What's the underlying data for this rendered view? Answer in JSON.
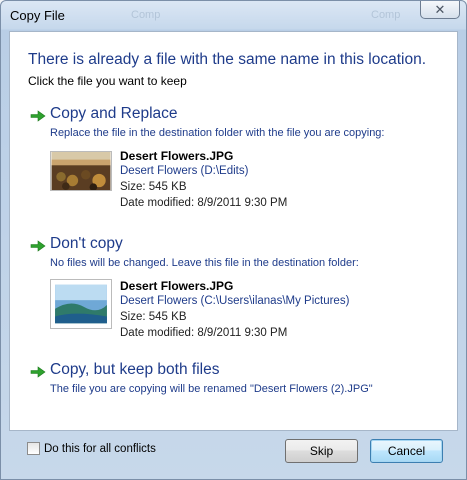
{
  "window": {
    "title": "Copy File",
    "ghost_left": "Comp",
    "ghost_right": "Comp"
  },
  "heading": "There is already a file with the same name in this location.",
  "subheading": "Click the file you want to keep",
  "options": [
    {
      "title": "Copy and Replace",
      "description": "Replace the file in the destination folder with the file you are copying:",
      "file": {
        "name": "Desert Flowers.JPG",
        "path": "Desert Flowers (D:\\Edits)",
        "size": "Size: 545 KB",
        "date": "Date modified: 8/9/2011 9:30 PM"
      }
    },
    {
      "title": "Don't copy",
      "description": "No files will be changed. Leave this file in the destination folder:",
      "file": {
        "name": "Desert Flowers.JPG",
        "path": "Desert Flowers (C:\\Users\\ilanas\\My Pictures)",
        "size": "Size: 545 KB",
        "date": "Date modified: 8/9/2011 9:30 PM"
      }
    },
    {
      "title": "Copy, but keep both files",
      "description": "The file you are copying will be renamed \"Desert Flowers (2).JPG\""
    }
  ],
  "footer": {
    "checkbox_label": "Do this for all conflicts",
    "skip_label": "Skip",
    "cancel_label": "Cancel"
  },
  "colors": {
    "link_blue": "#1e3b8a",
    "arrow_green": "#2ea12e"
  }
}
